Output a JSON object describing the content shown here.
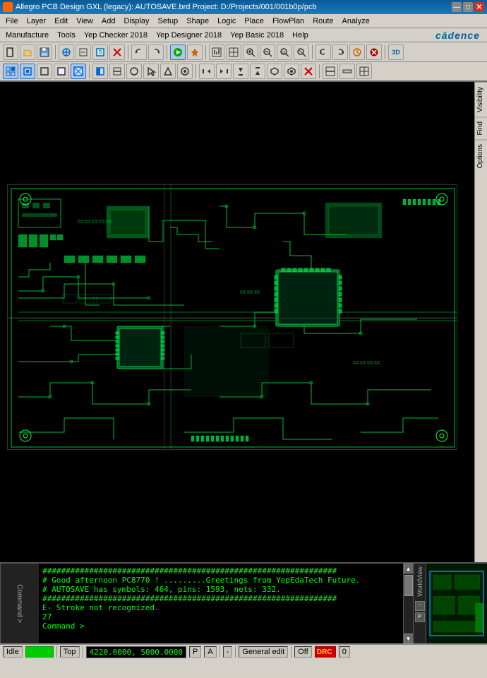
{
  "titlebar": {
    "title": "Allegro PCB Design GXL (legacy): AUTOSAVE.brd  Project: D:/Projects/001/001b0p/pcb",
    "icon_label": "A",
    "min_btn": "—",
    "max_btn": "□",
    "close_btn": "✕"
  },
  "menubar1": {
    "items": [
      "File",
      "Layer",
      "Edit",
      "View",
      "Add",
      "Display",
      "Setup",
      "Shape",
      "Logic",
      "Place",
      "FlowPlan",
      "Route",
      "Analyze"
    ]
  },
  "menubar2": {
    "items": [
      "Manufacture",
      "Tools",
      "Yep Checker 2018",
      "Yep Designer 2018",
      "Yep Basic 2018",
      "Help"
    ],
    "logo": "cādence"
  },
  "toolbar1": {
    "buttons": [
      {
        "name": "new",
        "icon": "□",
        "tooltip": "New"
      },
      {
        "name": "open",
        "icon": "📂",
        "tooltip": "Open"
      },
      {
        "name": "save",
        "icon": "💾",
        "tooltip": "Save"
      },
      {
        "name": "sep1"
      },
      {
        "name": "add-connect",
        "icon": "+",
        "tooltip": "Add Connect"
      },
      {
        "name": "add-staggered",
        "icon": "⊕",
        "tooltip": "Add Staggered"
      },
      {
        "name": "add-symbol",
        "icon": "▣",
        "tooltip": "Add Symbol"
      },
      {
        "name": "cross-mark",
        "icon": "✕",
        "tooltip": "Delete",
        "active": false
      },
      {
        "name": "sep2"
      },
      {
        "name": "undo",
        "icon": "↩",
        "tooltip": "Undo"
      },
      {
        "name": "redo",
        "icon": "↪",
        "tooltip": "Redo"
      },
      {
        "name": "sep3"
      },
      {
        "name": "green-run",
        "icon": "▶",
        "tooltip": "Run",
        "active": true
      },
      {
        "name": "pin",
        "icon": "📌",
        "tooltip": "Pin"
      },
      {
        "name": "sep4"
      },
      {
        "name": "board-stats",
        "icon": "⊞",
        "tooltip": "Board Statistics"
      },
      {
        "name": "floor-plan",
        "icon": "▦",
        "tooltip": "Floorplan"
      },
      {
        "name": "zoom-in",
        "icon": "🔍+",
        "tooltip": "Zoom In"
      },
      {
        "name": "zoom-out",
        "icon": "🔍-",
        "tooltip": "Zoom Out"
      },
      {
        "name": "zoom-fit",
        "icon": "⊡",
        "tooltip": "Zoom Fit"
      },
      {
        "name": "zoom-world",
        "icon": "⊞",
        "tooltip": "Zoom World"
      },
      {
        "name": "sep5"
      },
      {
        "name": "prev-view",
        "icon": "↺",
        "tooltip": "Previous View"
      },
      {
        "name": "next-view",
        "icon": "↻",
        "tooltip": "Next View"
      },
      {
        "name": "refresh",
        "icon": "⟳",
        "tooltip": "Refresh"
      },
      {
        "name": "abort",
        "icon": "⊗",
        "tooltip": "Abort"
      },
      {
        "name": "sep6"
      },
      {
        "name": "3d",
        "icon": "3D",
        "tooltip": "3D View"
      }
    ]
  },
  "toolbar2": {
    "buttons": [
      {
        "name": "grid-toggle",
        "icon": "⊞",
        "tooltip": "Grid"
      },
      {
        "name": "snap-grid",
        "icon": "□",
        "tooltip": "Snap to Grid"
      },
      {
        "name": "snap-corner",
        "icon": "◫",
        "tooltip": "Snap to Corner"
      },
      {
        "name": "snap-sym",
        "icon": "◻",
        "tooltip": "Snap Symbol"
      },
      {
        "name": "snap-via",
        "icon": "▣",
        "tooltip": "Snap Via"
      },
      {
        "name": "sep1"
      },
      {
        "name": "options1",
        "icon": "◧",
        "tooltip": "Options 1"
      },
      {
        "name": "options2",
        "icon": "⬚",
        "tooltip": "Options 2"
      },
      {
        "name": "options3",
        "icon": "○",
        "tooltip": "Options 3"
      },
      {
        "name": "options4",
        "icon": "↖",
        "tooltip": "Select"
      },
      {
        "name": "options5",
        "icon": "△",
        "tooltip": "Options 5"
      },
      {
        "name": "options6",
        "icon": "○",
        "tooltip": "Options 6"
      },
      {
        "name": "sep2"
      },
      {
        "name": "visibility1",
        "icon": "◁",
        "tooltip": "Visibility 1"
      },
      {
        "name": "visibility2",
        "icon": "▷",
        "tooltip": "Visibility 2"
      },
      {
        "name": "visibility3",
        "icon": "△",
        "tooltip": "Visibility 3"
      },
      {
        "name": "visibility4",
        "icon": "▽",
        "tooltip": "Visibility 4"
      },
      {
        "name": "visibility5",
        "icon": "◇",
        "tooltip": "Visibility 5"
      },
      {
        "name": "visibility6",
        "icon": "◈",
        "tooltip": "Visibility 6"
      },
      {
        "name": "cross-red",
        "icon": "✕",
        "tooltip": "Stop"
      },
      {
        "name": "sep3"
      },
      {
        "name": "board-pad",
        "icon": "⊠",
        "tooltip": "Board Pad"
      },
      {
        "name": "ruler1",
        "icon": "⊟",
        "tooltip": "Ruler 1"
      },
      {
        "name": "ruler2",
        "icon": "⊞",
        "tooltip": "Ruler 2"
      }
    ]
  },
  "right_panel": {
    "tabs": [
      "Visibility",
      "Find",
      "Options"
    ]
  },
  "console": {
    "label": "Command >",
    "lines": [
      "###############################################################",
      "# Good afternoon PC8770 !      .........Greetings from YepEdaTech Future.",
      "# AUTOSAVE has symbols: 464, pins: 1593, nets: 332.",
      "###############################################################",
      "E- Stroke not recognized.",
      "27",
      "Command >"
    ]
  },
  "worldview": {
    "label": "WorldView",
    "buttons": [
      "-",
      "P"
    ]
  },
  "statusbar": {
    "mode": "Idle",
    "layer": "Top",
    "coords": "4220.0000, 5000.0000",
    "snap_mode": "P",
    "snap_angle": "A",
    "separator": "-",
    "edit_mode": "General edit",
    "off_label": "Off",
    "error_count": "0"
  }
}
